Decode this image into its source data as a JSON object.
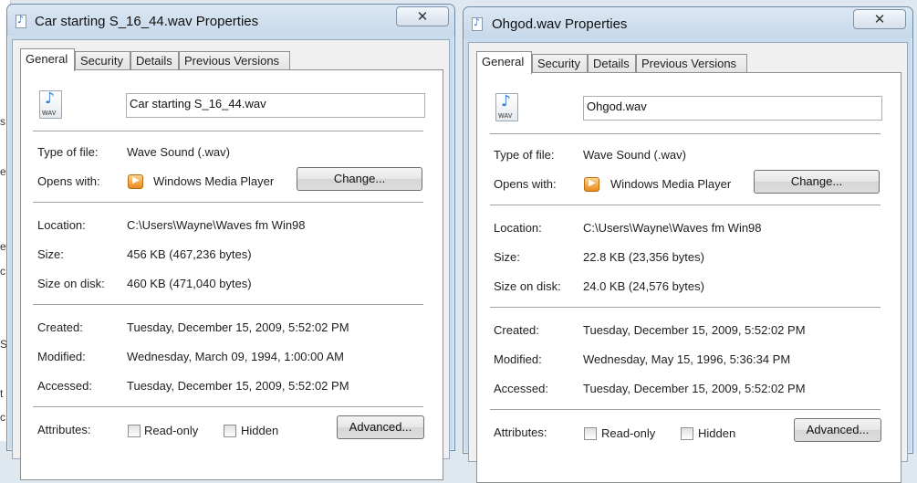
{
  "background": {
    "fragments": [
      "s",
      "e",
      "c",
      "S",
      "t",
      "c"
    ]
  },
  "icons": {
    "title": "wav-file-icon",
    "file": "wav-file-icon",
    "opens_with": "windows-media-player-icon",
    "close": "close-icon"
  },
  "colors": {
    "title_bar": "#c9dcee",
    "panel": "#ffffff",
    "client": "#f0f0f0"
  },
  "dialogs": [
    {
      "title": "Car starting S_16_44.wav Properties",
      "close_label": "✕",
      "tabs": [
        "General",
        "Security",
        "Details",
        "Previous Versions"
      ],
      "icon_label": "WAV",
      "file_name": "Car starting S_16_44.wav",
      "type_of_file_label": "Type of file:",
      "type_of_file": "Wave Sound (.wav)",
      "opens_with_label": "Opens with:",
      "opens_with": "Windows Media Player",
      "change_button": "Change...",
      "location_label": "Location:",
      "location": "C:\\Users\\Wayne\\Waves fm Win98",
      "size_label": "Size:",
      "size": "456 KB (467,236 bytes)",
      "size_on_disk_label": "Size on disk:",
      "size_on_disk": "460 KB (471,040 bytes)",
      "created_label": "Created:",
      "created": "Tuesday, December 15, 2009, 5:52:02 PM",
      "modified_label": "Modified:",
      "modified": "Wednesday, March 09, 1994, 1:00:00 AM",
      "accessed_label": "Accessed:",
      "accessed": "Tuesday, December 15, 2009, 5:52:02 PM",
      "attributes_label": "Attributes:",
      "readonly_label": "Read-only",
      "hidden_label": "Hidden",
      "advanced_button": "Advanced..."
    },
    {
      "title": "Ohgod.wav Properties",
      "close_label": "✕",
      "tabs": [
        "General",
        "Security",
        "Details",
        "Previous Versions"
      ],
      "icon_label": "WAV",
      "file_name": "Ohgod.wav",
      "type_of_file_label": "Type of file:",
      "type_of_file": "Wave Sound (.wav)",
      "opens_with_label": "Opens with:",
      "opens_with": "Windows Media Player",
      "change_button": "Change...",
      "location_label": "Location:",
      "location": "C:\\Users\\Wayne\\Waves fm Win98",
      "size_label": "Size:",
      "size": "22.8 KB (23,356 bytes)",
      "size_on_disk_label": "Size on disk:",
      "size_on_disk": "24.0 KB (24,576 bytes)",
      "created_label": "Created:",
      "created": "Tuesday, December 15, 2009, 5:52:02 PM",
      "modified_label": "Modified:",
      "modified": "Wednesday, May 15, 1996, 5:36:34 PM",
      "accessed_label": "Accessed:",
      "accessed": "Tuesday, December 15, 2009, 5:52:02 PM",
      "attributes_label": "Attributes:",
      "readonly_label": "Read-only",
      "hidden_label": "Hidden",
      "advanced_button": "Advanced..."
    }
  ]
}
